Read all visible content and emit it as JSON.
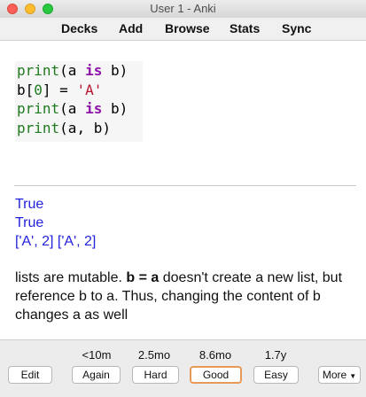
{
  "window": {
    "title": "User 1 - Anki"
  },
  "toolbar": {
    "items": [
      "Decks",
      "Add",
      "Browse",
      "Stats",
      "Sync"
    ]
  },
  "code": {
    "l1": {
      "a": "print",
      "b": "(a ",
      "c": "is",
      "d": " b)"
    },
    "l2": {
      "a": "b[",
      "b": "0",
      "c": "] = ",
      "d": "'A'"
    },
    "l3": {
      "a": "print",
      "b": "(a ",
      "c": "is",
      "d": " b)"
    },
    "l4": {
      "a": "print",
      "b": "(a, b)"
    }
  },
  "output": [
    "True",
    "True",
    "['A', 2] ['A', 2]"
  ],
  "explanation": {
    "p1": "lists are mutable. ",
    "bold": "b = a",
    "p2": " doesn't create a new list, but reference b to a. Thus, changing the content of b changes a as well"
  },
  "answer": {
    "intervals": [
      "<10m",
      "2.5mo",
      "8.6mo",
      "1.7y"
    ],
    "edit_label": "Edit",
    "again_label": "Again",
    "hard_label": "Hard",
    "good_label": "Good",
    "easy_label": "Easy",
    "more_label": "More",
    "more_chevron": "▼"
  },
  "colors": {
    "output_blue": "#2222dd",
    "keyword_purple": "#8c13a8",
    "string_red": "#b5152e",
    "func_green": "#1f7a1f",
    "good_outline": "#e79a58"
  }
}
